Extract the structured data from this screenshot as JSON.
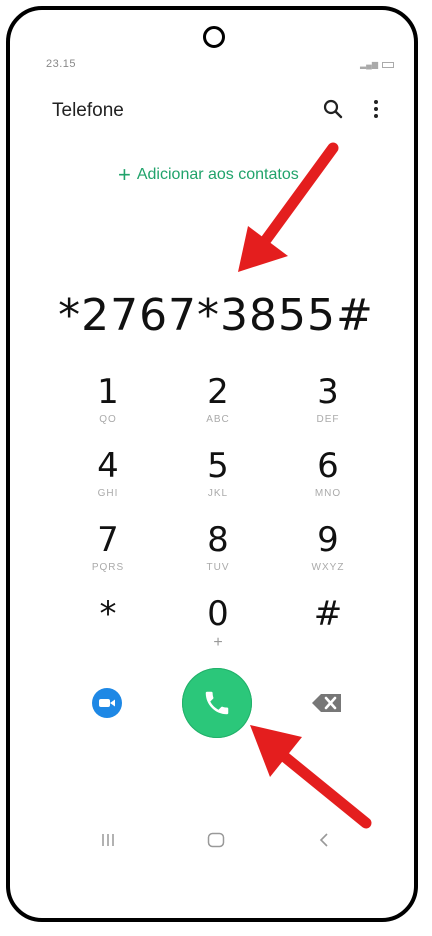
{
  "status_bar": {
    "time": "23.15"
  },
  "app_header": {
    "title": "Telefone",
    "search_icon": "search-icon",
    "menu_icon": "more-vert-icon"
  },
  "add_contact": {
    "plus": "+",
    "label": "Adicionar aos contatos"
  },
  "dialer": {
    "number": "*2767*3855#"
  },
  "keypad": {
    "keys": [
      {
        "digit": "1",
        "letters": "QO"
      },
      {
        "digit": "2",
        "letters": "ABC"
      },
      {
        "digit": "3",
        "letters": "DEF"
      },
      {
        "digit": "4",
        "letters": "GHI"
      },
      {
        "digit": "5",
        "letters": "JKL"
      },
      {
        "digit": "6",
        "letters": "MNO"
      },
      {
        "digit": "7",
        "letters": "PQRS"
      },
      {
        "digit": "8",
        "letters": "TUV"
      },
      {
        "digit": "9",
        "letters": "WXYZ"
      },
      {
        "digit": "*",
        "letters": ""
      },
      {
        "digit": "0",
        "letters": "+"
      },
      {
        "digit": "#",
        "letters": ""
      }
    ]
  },
  "actions": {
    "video_icon": "video-call-icon",
    "call_icon": "phone-icon",
    "backspace_icon": "backspace-icon"
  },
  "colors": {
    "accent_green": "#21a36b",
    "call_green": "#2bc77a",
    "video_blue": "#1e88e5",
    "arrow_red": "#e41e1e"
  }
}
